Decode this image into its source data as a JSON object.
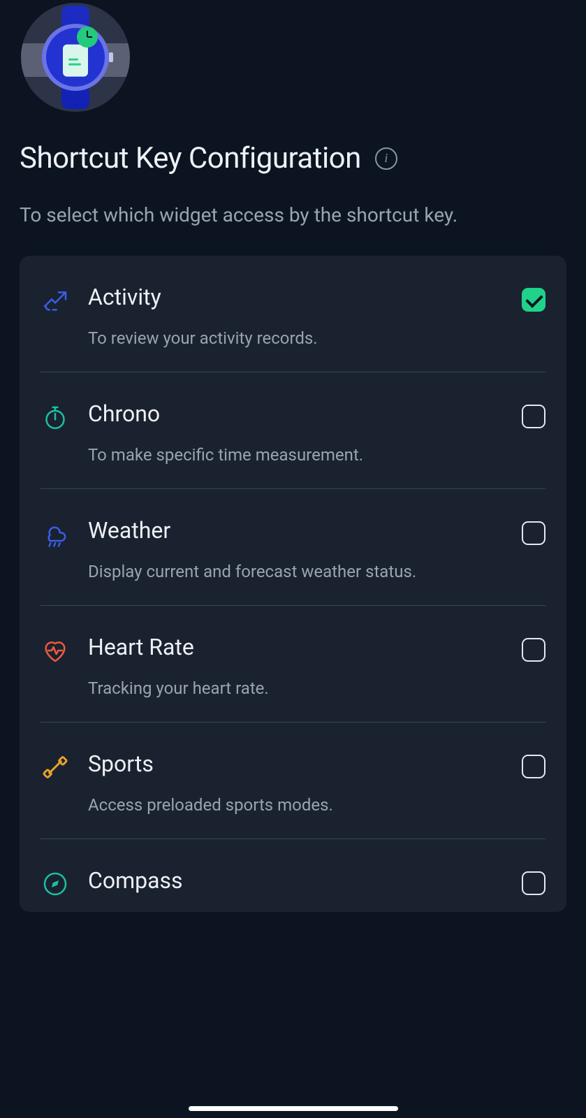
{
  "header": {
    "title": "Shortcut Key Configuration",
    "info_glyph": "i",
    "subtitle": "To select which widget access by the shortcut key."
  },
  "items": [
    {
      "id": "activity",
      "title": "Activity",
      "desc": "To review your activity records.",
      "checked": true,
      "icon": "activity-icon",
      "icon_color": "#3a5de8"
    },
    {
      "id": "chrono",
      "title": "Chrono",
      "desc": "To make specific time measurement.",
      "checked": false,
      "icon": "chrono-icon",
      "icon_color": "#1bbfa1"
    },
    {
      "id": "weather",
      "title": "Weather",
      "desc": "Display current and forecast weather status.",
      "checked": false,
      "icon": "weather-icon",
      "icon_color": "#3a5de8"
    },
    {
      "id": "heartrate",
      "title": "Heart Rate",
      "desc": "Tracking your heart rate.",
      "checked": false,
      "icon": "heart-icon",
      "icon_color": "#ef5b3d"
    },
    {
      "id": "sports",
      "title": "Sports",
      "desc": "Access preloaded sports modes.",
      "checked": false,
      "icon": "sports-icon",
      "icon_color": "#e9a22b"
    },
    {
      "id": "compass",
      "title": "Compass",
      "desc": "",
      "checked": false,
      "icon": "compass-icon",
      "icon_color": "#1bbfa1"
    }
  ]
}
